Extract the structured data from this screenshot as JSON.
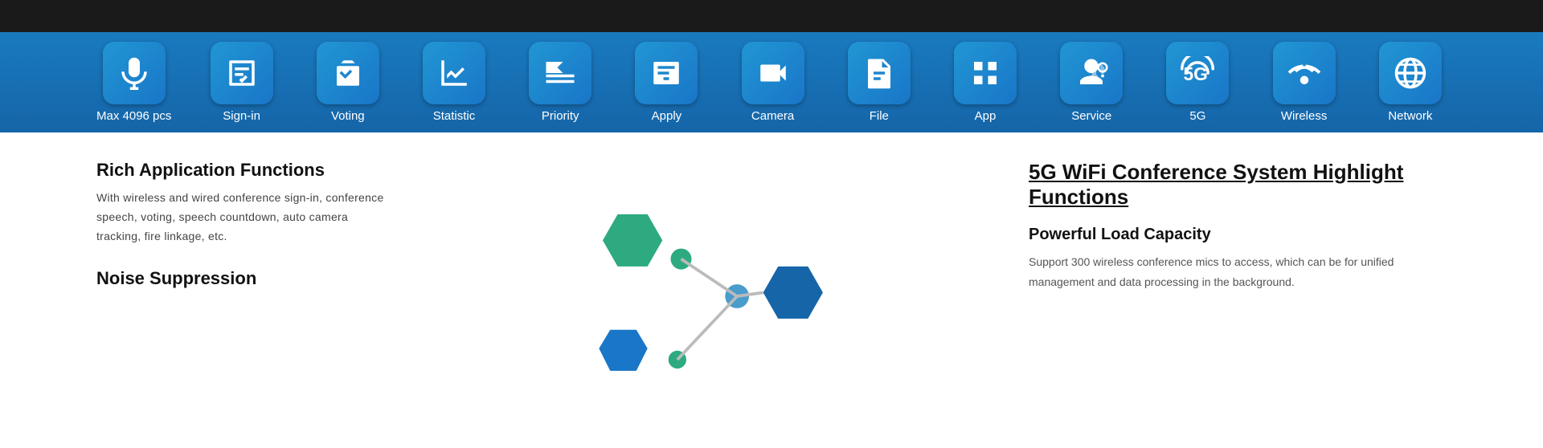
{
  "topBar": {
    "visible": true
  },
  "toolbar": {
    "items": [
      {
        "id": "max4096",
        "label": "Max 4096 pcs",
        "icon": "mic"
      },
      {
        "id": "signin",
        "label": "Sign-in",
        "icon": "signin"
      },
      {
        "id": "voting",
        "label": "Voting",
        "icon": "voting"
      },
      {
        "id": "statistic",
        "label": "Statistic",
        "icon": "statistic"
      },
      {
        "id": "priority",
        "label": "Priority",
        "icon": "priority"
      },
      {
        "id": "apply",
        "label": "Apply",
        "icon": "apply"
      },
      {
        "id": "camera",
        "label": "Camera",
        "icon": "camera"
      },
      {
        "id": "file",
        "label": "File",
        "icon": "file"
      },
      {
        "id": "app",
        "label": "App",
        "icon": "app"
      },
      {
        "id": "service",
        "label": "Service",
        "icon": "service"
      },
      {
        "id": "fiveg",
        "label": "5G",
        "icon": "fiveg"
      },
      {
        "id": "wireless",
        "label": "Wireless",
        "icon": "wireless"
      },
      {
        "id": "network",
        "label": "Network",
        "icon": "network"
      }
    ]
  },
  "left": {
    "richTitle": "Rich Application Functions",
    "richBody": "With wireless and wired conference sign-in, conference speech, voting, speech countdown, auto camera tracking, fire linkage, etc.",
    "noiseTitle": "Noise Suppression"
  },
  "right": {
    "highlightTitle": "5G WiFi Conference System  Highlight Functions",
    "powerTitle": "Powerful Load Capacity",
    "powerBody": "Support 300 wireless conference mics to access, which can be  for unified management and data processing in the background."
  }
}
